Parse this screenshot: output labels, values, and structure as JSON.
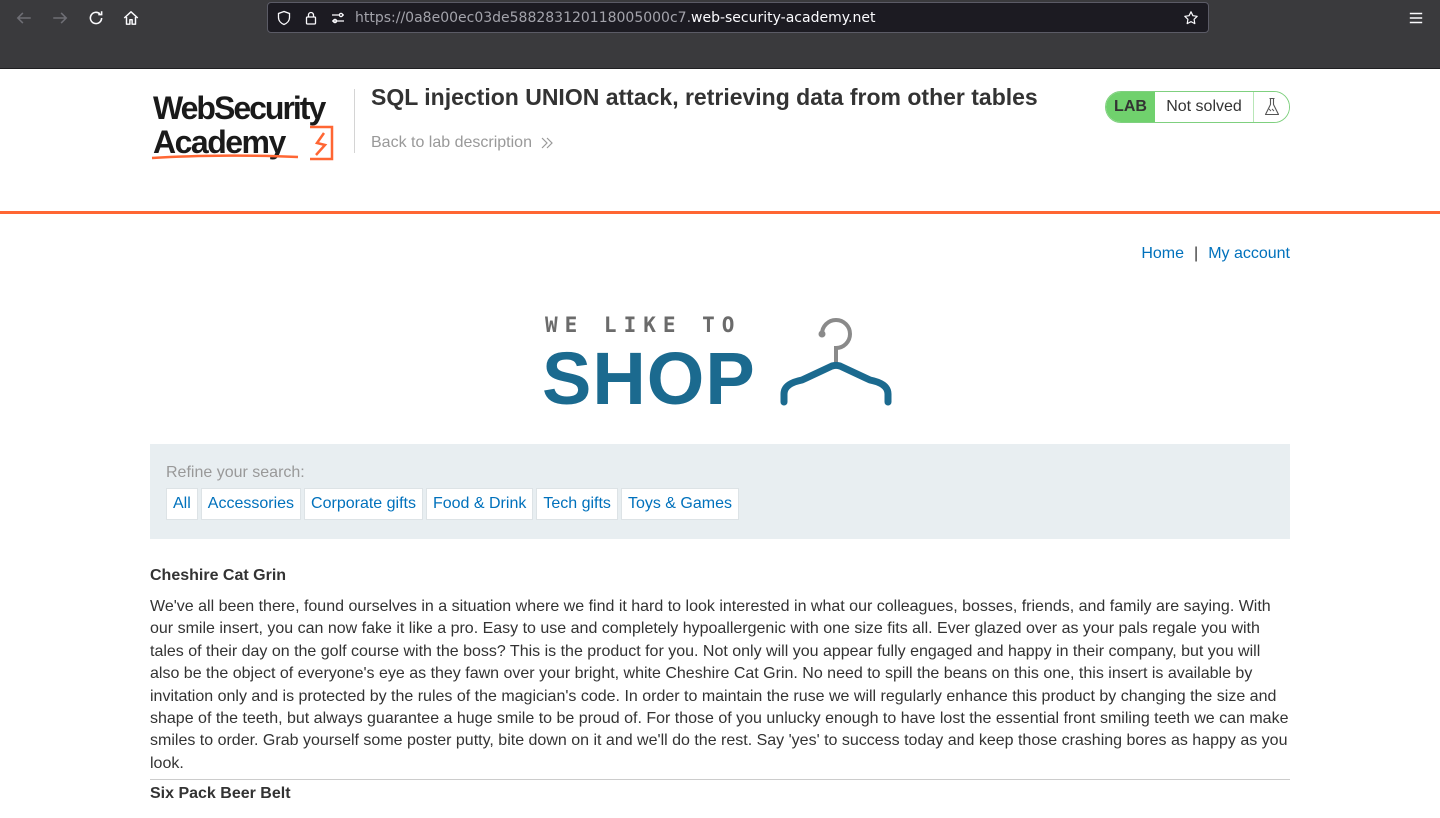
{
  "browser": {
    "url_prefix": "https://0a8e00ec03de588283120118005000c7.",
    "url_domain": "web-security-academy.net"
  },
  "lab": {
    "title": "SQL injection UNION attack, retrieving data from other tables",
    "back_link": "Back to lab description",
    "status_badge": "LAB",
    "status_text": "Not solved"
  },
  "brand": {
    "logo_line1": "WebSecurity",
    "logo_line2": "Academy",
    "accent_color": "#ff6633",
    "link_color": "#0071bc",
    "shop_logo_top": "WE LIKE TO",
    "shop_logo_main": "SHOP"
  },
  "nav": {
    "home": "Home",
    "separator": "|",
    "my_account": "My account"
  },
  "filter": {
    "label": "Refine your search:",
    "categories": [
      "All",
      "Accessories",
      "Corporate gifts",
      "Food & Drink",
      "Tech gifts",
      "Toys & Games"
    ]
  },
  "products": [
    {
      "name": "Cheshire Cat Grin",
      "description": "We've all been there, found ourselves in a situation where we find it hard to look interested in what our colleagues, bosses, friends, and family are saying. With our smile insert, you can now fake it like a pro. Easy to use and completely hypoallergenic with one size fits all. Ever glazed over as your pals regale you with tales of their day on the golf course with the boss? This is the product for you. Not only will you appear fully engaged and happy in their company, but you will also be the object of everyone's eye as they fawn over your bright, white Cheshire Cat Grin. No need to spill the beans on this one, this insert is available by invitation only and is protected by the rules of the magician's code. In order to maintain the ruse we will regularly enhance this product by changing the size and shape of the teeth, but always guarantee a huge smile to be proud of. For those of you unlucky enough to have lost the essential front smiling teeth we can make smiles to order. Grab yourself some poster putty, bite down on it and we'll do the rest. Say 'yes' to success today and keep those crashing bores as happy as you look."
    },
    {
      "name": "Six Pack Beer Belt"
    }
  ]
}
